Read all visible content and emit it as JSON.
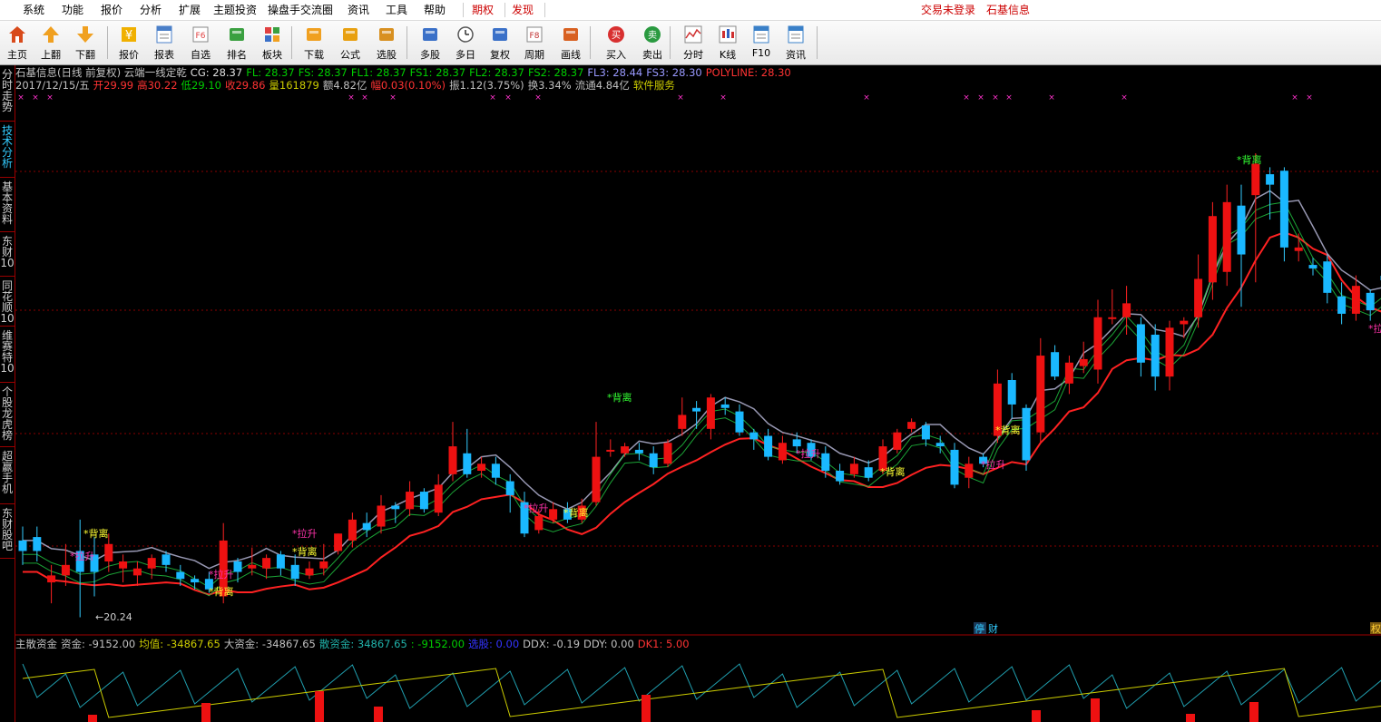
{
  "menubar": {
    "items": [
      "系统",
      "功能",
      "报价",
      "分析",
      "扩展",
      "主题投资",
      "操盘手交流圈",
      "资讯",
      "工具",
      "帮助"
    ],
    "highlight": [
      "期权",
      "发现"
    ],
    "login_status": "交易未登录",
    "stock_name": "石基信息"
  },
  "toolbar": {
    "buttons": [
      {
        "label": "主页",
        "icon": "home-icon"
      },
      {
        "label": "上翻",
        "icon": "arrow-up-icon"
      },
      {
        "label": "下翻",
        "icon": "arrow-down-icon"
      },
      {
        "label": "报价",
        "icon": "yen-icon"
      },
      {
        "label": "报表",
        "icon": "report-icon"
      },
      {
        "label": "自选",
        "icon": "f6-icon"
      },
      {
        "label": "排名",
        "icon": "rank-icon"
      },
      {
        "label": "板块",
        "icon": "grid-icon"
      },
      {
        "label": "下载",
        "icon": "download-icon"
      },
      {
        "label": "公式",
        "icon": "formula-icon"
      },
      {
        "label": "选股",
        "icon": "select-stock-icon"
      },
      {
        "label": "多股",
        "icon": "multi-stock-icon"
      },
      {
        "label": "多日",
        "icon": "clock-icon"
      },
      {
        "label": "复权",
        "icon": "adjust-icon"
      },
      {
        "label": "周期",
        "icon": "f8-icon"
      },
      {
        "label": "画线",
        "icon": "draw-line-icon"
      },
      {
        "label": "买入",
        "icon": "buy-icon"
      },
      {
        "label": "卖出",
        "icon": "sell-icon"
      },
      {
        "label": "分时",
        "icon": "intraday-icon"
      },
      {
        "label": "K线",
        "icon": "kline-icon"
      },
      {
        "label": "F10",
        "icon": "f10-icon"
      },
      {
        "label": "资讯",
        "icon": "news-icon"
      }
    ]
  },
  "sidetabs": [
    {
      "label": "分时走势",
      "active": false
    },
    {
      "label": "技术分析",
      "active": true
    },
    {
      "label": "基本资料",
      "active": false
    },
    {
      "label": "东财10",
      "active": false
    },
    {
      "label": "同花顺10",
      "active": false
    },
    {
      "label": "维赛特10",
      "active": false
    },
    {
      "label": "个股龙虎榜",
      "active": false
    },
    {
      "label": "超赢手机",
      "active": false
    },
    {
      "label": "东财股吧",
      "active": false
    }
  ],
  "header": {
    "line1": [
      {
        "text": "石基信息(日线 前复权) 云端一线定乾",
        "color": "#c0c0c0"
      },
      {
        "text": "CG: 28.37",
        "color": "#e0e0e0"
      },
      {
        "text": "FL: 28.37",
        "color": "#00cc00"
      },
      {
        "text": "FS: 28.37",
        "color": "#00cc00"
      },
      {
        "text": "FL1: 28.37",
        "color": "#00cc00"
      },
      {
        "text": "FS1: 28.37",
        "color": "#00cc00"
      },
      {
        "text": "FL2: 28.37",
        "color": "#00cc00"
      },
      {
        "text": "FS2: 28.37",
        "color": "#00cc00"
      },
      {
        "text": "FL3: 28.44",
        "color": "#9999ff"
      },
      {
        "text": "FS3: 28.30",
        "color": "#9999ff"
      },
      {
        "text": "POLYLINE: 28.30",
        "color": "#ff3333"
      }
    ],
    "line2": [
      {
        "text": "2017/12/15/五",
        "color": "#c0c0c0"
      },
      {
        "text": "开29.99",
        "color": "#ff3333"
      },
      {
        "text": "高30.22",
        "color": "#ff3333"
      },
      {
        "text": "低29.10",
        "color": "#00cc00"
      },
      {
        "text": "收29.86",
        "color": "#ff3333"
      },
      {
        "text": "量161879",
        "color": "#cccc00"
      },
      {
        "text": "额4.82亿",
        "color": "#c0c0c0"
      },
      {
        "text": "幅0.03(0.10%)",
        "color": "#ff3333"
      },
      {
        "text": "振1.12(3.75%)",
        "color": "#c0c0c0"
      },
      {
        "text": "换3.34%",
        "color": "#c0c0c0"
      },
      {
        "text": "流通4.84亿",
        "color": "#c0c0c0"
      },
      {
        "text": "软件服务",
        "color": "#cccc00"
      }
    ]
  },
  "sub_header": [
    {
      "text": "主散资金",
      "color": "#c0c0c0"
    },
    {
      "text": "资金: -9152.00",
      "color": "#c0c0c0"
    },
    {
      "text": "均值: -34867.65",
      "color": "#cccc00"
    },
    {
      "text": "大资金: -34867.65",
      "color": "#c0c0c0"
    },
    {
      "text": "散资金: 34867.65",
      "color": "#20b2aa"
    },
    {
      "text": ": -9152.00",
      "color": "#00cc00"
    },
    {
      "text": "选股: 0.00",
      "color": "#3333ff"
    },
    {
      "text": "DDX: -0.19",
      "color": "#c0c0c0"
    },
    {
      "text": "DDY: 0.00",
      "color": "#c0c0c0"
    },
    {
      "text": "DK1: 5.00",
      "color": "#ff3333"
    }
  ],
  "annotations": {
    "low_price": "20.24",
    "stop_badge": "停",
    "finance_badge": "财",
    "right_badge": "权"
  },
  "chart_data": {
    "type": "candlestick",
    "ymin_visible": 20.24,
    "marker_labels": [
      "拉升",
      "背离"
    ],
    "candles": [
      [
        22.4,
        22.1,
        22.8,
        21.7
      ],
      [
        22.5,
        22.1,
        22.8,
        21.8
      ],
      [
        21.2,
        21.4,
        21.7,
        20.6
      ],
      [
        21.4,
        21.7,
        22.3,
        21.1
      ],
      [
        22.1,
        21.5,
        23.0,
        20.2
      ],
      [
        22.0,
        21.5,
        22.5,
        20.8
      ],
      [
        21.8,
        22.3,
        22.6,
        21.5
      ],
      [
        21.6,
        21.8,
        22.0,
        21.2
      ],
      [
        21.4,
        21.6,
        21.8,
        21.1
      ],
      [
        21.6,
        21.9,
        22.0,
        21.3
      ],
      [
        22.0,
        21.7,
        22.1,
        21.5
      ],
      [
        21.5,
        21.3,
        21.7,
        21.1
      ],
      [
        21.3,
        21.2,
        21.4,
        21.0
      ],
      [
        21.3,
        21.0,
        21.5,
        20.9
      ],
      [
        20.8,
        22.4,
        22.9,
        20.6
      ],
      [
        21.8,
        21.5,
        21.9,
        21.2
      ],
      [
        21.6,
        21.7,
        22.2,
        21.4
      ],
      [
        21.6,
        21.9,
        22.0,
        21.3
      ],
      [
        22.0,
        21.6,
        22.1,
        21.4
      ],
      [
        21.7,
        21.3,
        22.0,
        21.1
      ],
      [
        21.4,
        21.6,
        21.8,
        21.3
      ],
      [
        21.6,
        21.8,
        22.3,
        21.4
      ],
      [
        22.1,
        22.6,
        22.6,
        22.0
      ],
      [
        22.4,
        23.0,
        23.2,
        22.2
      ],
      [
        22.9,
        22.7,
        23.2,
        22.5
      ],
      [
        22.8,
        23.4,
        23.7,
        22.6
      ],
      [
        23.4,
        23.3,
        23.5,
        22.9
      ],
      [
        23.3,
        23.8,
        24.1,
        23.1
      ],
      [
        23.8,
        23.3,
        23.9,
        23.2
      ],
      [
        23.2,
        24.0,
        24.3,
        23.1
      ],
      [
        24.3,
        25.1,
        25.8,
        24.1
      ],
      [
        24.9,
        24.3,
        25.6,
        24.2
      ],
      [
        24.4,
        24.6,
        24.8,
        24.2
      ],
      [
        24.6,
        24.2,
        24.8,
        24.0
      ],
      [
        24.1,
        23.7,
        24.3,
        23.2
      ],
      [
        23.5,
        22.6,
        23.8,
        22.5
      ],
      [
        22.7,
        23.1,
        23.3,
        22.6
      ],
      [
        23.0,
        23.3,
        23.5,
        22.9
      ],
      [
        23.3,
        23.0,
        23.5,
        22.9
      ],
      [
        23.0,
        23.4,
        23.6,
        22.9
      ],
      [
        23.5,
        24.8,
        25.8,
        23.4
      ],
      [
        25.0,
        25.0,
        25.3,
        24.8
      ],
      [
        24.9,
        25.1,
        25.2,
        24.8
      ],
      [
        25.0,
        24.9,
        25.2,
        24.7
      ],
      [
        24.9,
        24.5,
        25.1,
        24.3
      ],
      [
        24.6,
        25.2,
        25.3,
        24.5
      ],
      [
        25.6,
        26.0,
        26.5,
        25.4
      ],
      [
        26.2,
        26.1,
        26.4,
        25.6
      ],
      [
        25.6,
        26.5,
        26.6,
        25.3
      ],
      [
        26.3,
        26.2,
        26.5,
        26.0
      ],
      [
        26.1,
        25.5,
        26.3,
        25.4
      ],
      [
        25.5,
        25.3,
        25.6,
        25.0
      ],
      [
        25.4,
        24.8,
        25.6,
        24.7
      ],
      [
        24.7,
        25.2,
        25.4,
        24.6
      ],
      [
        25.3,
        25.1,
        25.5,
        24.9
      ],
      [
        25.2,
        24.8,
        25.3,
        24.7
      ],
      [
        24.9,
        24.4,
        25.1,
        24.2
      ],
      [
        24.4,
        24.1,
        24.6,
        24.0
      ],
      [
        24.3,
        24.6,
        24.8,
        24.2
      ],
      [
        24.5,
        24.2,
        24.7,
        24.1
      ],
      [
        24.4,
        25.1,
        25.3,
        24.3
      ],
      [
        25.0,
        25.5,
        25.6,
        24.9
      ],
      [
        25.6,
        25.8,
        25.9,
        25.5
      ],
      [
        25.7,
        25.3,
        25.8,
        25.1
      ],
      [
        25.2,
        25.1,
        25.4,
        24.9
      ],
      [
        25.0,
        24.0,
        25.2,
        23.9
      ],
      [
        24.2,
        24.6,
        24.8,
        23.9
      ],
      [
        24.8,
        24.6,
        24.9,
        24.5
      ],
      [
        25.4,
        26.9,
        27.3,
        25.2
      ],
      [
        27.0,
        26.3,
        27.2,
        25.9
      ],
      [
        26.2,
        24.7,
        26.3,
        24.4
      ],
      [
        25.5,
        27.7,
        28.2,
        25.2
      ],
      [
        27.8,
        27.1,
        28.0,
        27.0
      ],
      [
        26.9,
        27.5,
        27.7,
        26.6
      ],
      [
        27.4,
        27.6,
        28.1,
        27.2
      ],
      [
        27.3,
        28.8,
        29.3,
        26.9
      ],
      [
        28.8,
        28.8,
        29.6,
        28.6
      ],
      [
        28.8,
        29.2,
        29.7,
        28.3
      ],
      [
        28.6,
        27.5,
        28.8,
        27.1
      ],
      [
        28.3,
        27.1,
        28.6,
        26.7
      ],
      [
        27.1,
        28.5,
        28.7,
        26.7
      ],
      [
        28.6,
        28.7,
        28.8,
        28.2
      ],
      [
        28.8,
        29.9,
        30.6,
        28.5
      ],
      [
        29.8,
        31.7,
        32.1,
        29.3
      ],
      [
        30.1,
        32.1,
        32.6,
        29.7
      ],
      [
        32.0,
        30.6,
        32.6,
        29.1
      ],
      [
        32.3,
        33.2,
        33.5,
        29.8
      ],
      [
        32.9,
        32.6,
        33.1,
        31.6
      ],
      [
        33.0,
        30.8,
        33.1,
        30.4
      ],
      [
        30.7,
        30.8,
        31.2,
        30.4
      ],
      [
        30.3,
        30.2,
        30.5,
        30.0
      ],
      [
        30.4,
        29.5,
        30.6,
        29.2
      ],
      [
        29.4,
        28.9,
        29.8,
        28.6
      ],
      [
        28.9,
        29.7,
        30.0,
        28.7
      ],
      [
        29.5,
        29.0,
        29.6,
        28.7
      ],
      [
        29.99,
        29.86,
        30.22,
        29.1
      ]
    ]
  }
}
